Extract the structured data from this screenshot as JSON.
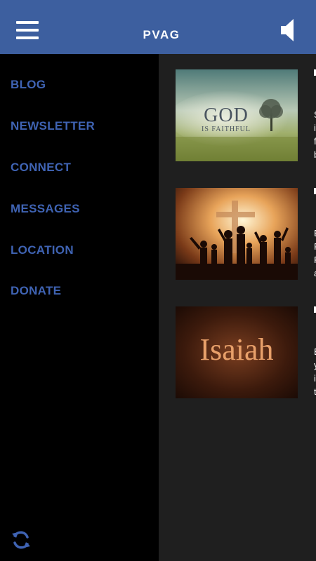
{
  "header": {
    "title": "PVAG",
    "menu_icon": "hamburger-menu-icon",
    "sound_icon": "speaker-icon",
    "background": "#3d5f9f"
  },
  "sidebar": {
    "items": [
      {
        "label": "BLOG"
      },
      {
        "label": "NEWSLETTER"
      },
      {
        "label": "CONNECT"
      },
      {
        "label": "MESSAGES"
      },
      {
        "label": "LOCATION"
      },
      {
        "label": "DONATE"
      }
    ],
    "refresh_icon": "refresh-icon",
    "link_color": "#3f63b3"
  },
  "posts": [
    {
      "image_text_main": "GOD",
      "image_text_sub": "IS FAITHFUL",
      "peek_lines": [
        "S",
        "i",
        "f",
        "b"
      ]
    },
    {
      "image_text_main": "",
      "peek_lines": [
        "E",
        "F",
        "F",
        "a"
      ]
    },
    {
      "image_text_main": "Isaiah",
      "peek_lines": [
        "E",
        "y",
        "i",
        "t"
      ]
    }
  ]
}
